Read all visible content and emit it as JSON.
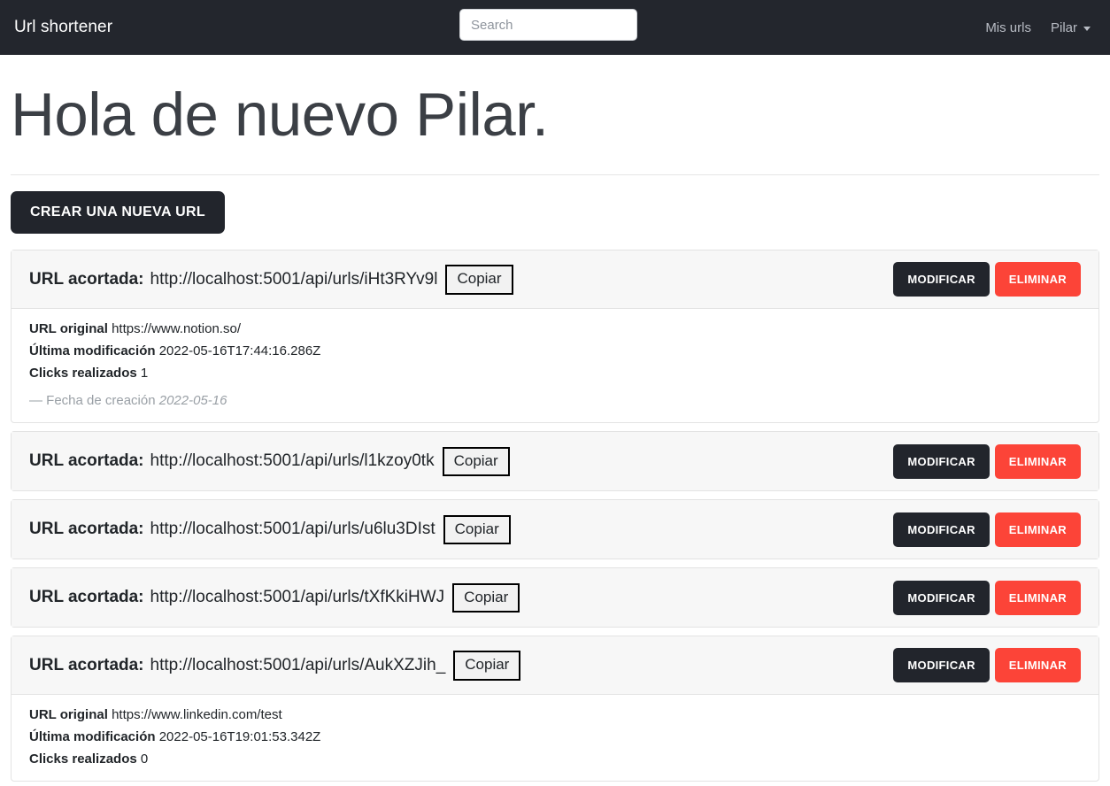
{
  "navbar": {
    "brand": "Url shortener",
    "search": {
      "placeholder": "Search",
      "value": ""
    },
    "links": [
      {
        "label": "Mis urls",
        "name": "nav-link-mis-urls"
      }
    ],
    "user_menu": {
      "label": "Pilar",
      "caret": "chevron-down-icon"
    }
  },
  "hero": {
    "title": "Hola de nuevo Pilar."
  },
  "actions": {
    "create_label": "CREAR UNA NUEVA URL"
  },
  "labels": {
    "short_url": "URL acortada:",
    "copy": "Copiar",
    "modify": "MODIFICAR",
    "delete": "ELIMINAR",
    "original_url": "URL original",
    "last_modified": "Última modificación",
    "clicks": "Clicks realizados",
    "created_prefix": "— Fecha de creación"
  },
  "colors": {
    "navbar_bg": "#23262d",
    "dark_button": "#22252c",
    "delete_red": "#fc4438",
    "card_header_bg": "#f7f7f7",
    "muted_text": "#9aa0a6"
  },
  "urls": [
    {
      "short_url": "http://localhost:5001/api/urls/iHt3RYv9l",
      "expanded": true,
      "original_url": "https://www.notion.so/",
      "last_modified": "2022-05-16T17:44:16.286Z",
      "clicks": "1",
      "created_date": "2022-05-16"
    },
    {
      "short_url": "http://localhost:5001/api/urls/l1kzoy0tk",
      "expanded": false
    },
    {
      "short_url": "http://localhost:5001/api/urls/u6lu3DIst",
      "expanded": false
    },
    {
      "short_url": "http://localhost:5001/api/urls/tXfKkiHWJ",
      "expanded": false
    },
    {
      "short_url": "http://localhost:5001/api/urls/AukXZJih_",
      "expanded": true,
      "original_url": "https://www.linkedin.com/test",
      "last_modified": "2022-05-16T19:01:53.342Z",
      "clicks": "0",
      "created_date": ""
    }
  ]
}
